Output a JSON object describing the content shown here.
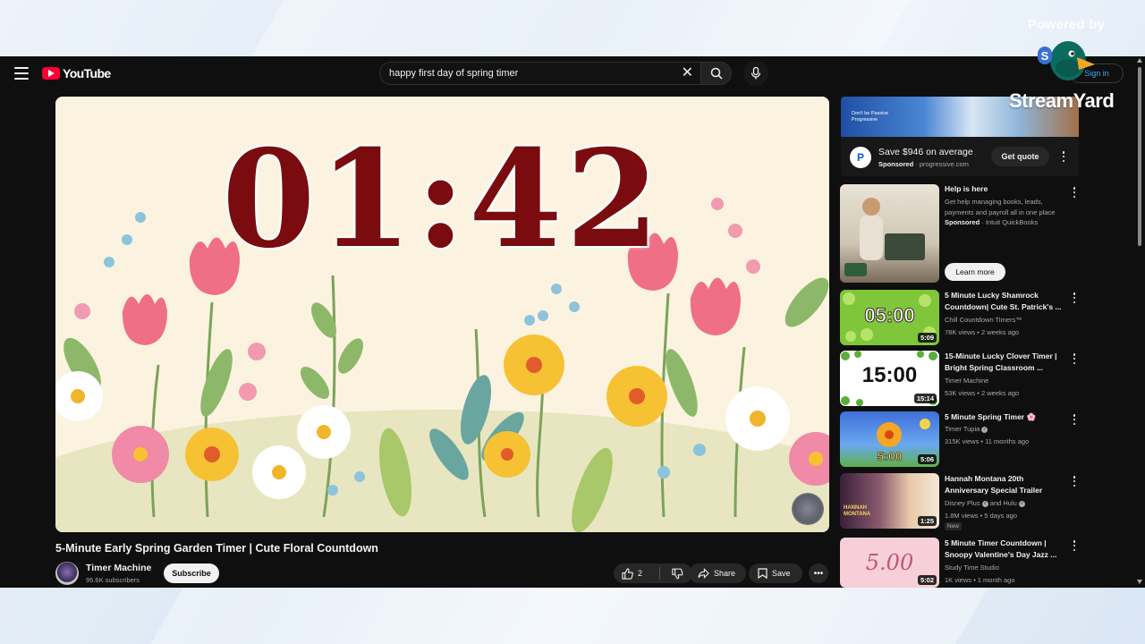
{
  "overlay": {
    "powered_by": "Powered by",
    "brand": "StreamYard"
  },
  "youtube": {
    "logo_text": "YouTube",
    "search": {
      "value": "happy first day of spring timer"
    },
    "signin_label": "Sign in",
    "player": {
      "timer_display": "01:42"
    },
    "video": {
      "title": "5-Minute Early Spring Garden Timer | Cute Floral Countdown",
      "channel": "Timer Machine",
      "subscribers": "95.6K subscribers",
      "subscribe_label": "Subscribe",
      "like_count": "2",
      "share_label": "Share",
      "save_label": "Save"
    },
    "ad_banner": {
      "tagline": "Don't be Passive\nProgressive",
      "title": "Save $946 on average",
      "sponsored": "Sponsored",
      "domain": "progressive.com",
      "cta": "Get quote",
      "logo_letter": "P"
    },
    "ad_card": {
      "title": "Help is here",
      "description": "Get help managing books, leads, payments and payroll all in one place",
      "sponsored": "Sponsored",
      "advertiser": "Intuit QuickBooks",
      "cta": "Learn more"
    },
    "recommendations": [
      {
        "title": "5 Minute Lucky Shamrock Countdown| Cute St. Patrick's ...",
        "channel": "Chill Countdown Timers™",
        "meta": "78K views • 2 weeks ago",
        "duration": "5:09",
        "thumb_text": "05:00"
      },
      {
        "title": "15-Minute Lucky Clover Timer | Bright Spring Classroom ...",
        "channel": "Timer Machine",
        "meta": "53K views • 2 weeks ago",
        "duration": "15:14",
        "thumb_text": "15:00"
      },
      {
        "title": "5 Minute Spring Timer 🌸",
        "channel": "Timer Tupia",
        "meta": "315K views • 11 months ago",
        "duration": "5:06",
        "thumb_text": "5:00"
      },
      {
        "title": "Hannah Montana 20th Anniversary Special Trailer",
        "channel": "Disney Plus",
        "channel_extra": "and Hulu",
        "meta": "1.8M views • 5 days ago",
        "badge": "New",
        "duration": "1:25",
        "thumb_text": "HANNAH MONTANA"
      },
      {
        "title": "5 Minute Timer Countdown | Snoopy Valentine's Day Jazz ...",
        "channel": "Study Time Studio",
        "meta": "1K views • 1 month ago",
        "duration": "5:02",
        "thumb_text": "5.00"
      }
    ]
  },
  "colors": {
    "timer_text": "#7a0c10",
    "accent_red": "#ff0033",
    "background": "#0f0f0f"
  }
}
